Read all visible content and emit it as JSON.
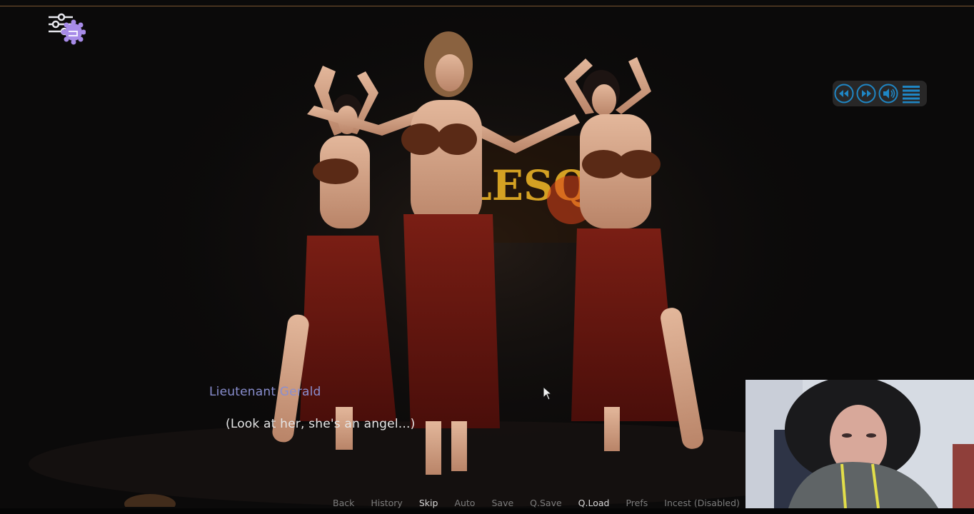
{
  "dialogue": {
    "speaker": "Lieutenant Gerald",
    "line": "(Look at her, she's an angel...)"
  },
  "quick_menu": [
    {
      "label": "Back",
      "highlight": false
    },
    {
      "label": "History",
      "highlight": false
    },
    {
      "label": "Skip",
      "highlight": true
    },
    {
      "label": "Auto",
      "highlight": false
    },
    {
      "label": "Save",
      "highlight": false
    },
    {
      "label": "Q.Save",
      "highlight": false
    },
    {
      "label": "Q.Load",
      "highlight": true
    },
    {
      "label": "Prefs",
      "highlight": false
    },
    {
      "label": "Incest (Disabled)",
      "highlight": false
    }
  ],
  "media_controls": [
    "rewind-icon",
    "fast-forward-icon",
    "volume-icon",
    "menu-icon"
  ],
  "icons": {
    "settings": "settings-sliders-icon"
  },
  "colors": {
    "speaker_name": "#8a8fd0",
    "dialogue_text": "#e6e6e6",
    "menu_dim": "#7c7c7c",
    "menu_bright": "#d6d6d6",
    "media_icon": "#1f86c4",
    "settings_gear": "#a78be8"
  }
}
